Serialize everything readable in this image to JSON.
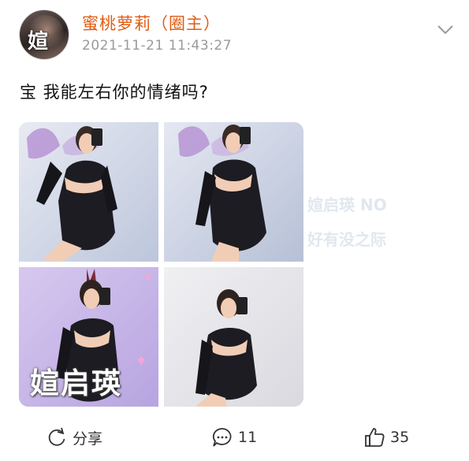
{
  "post": {
    "author": {
      "name": "蜜桃萝莉（圈主）",
      "avatar_watermark": "媗"
    },
    "timestamp": "2021-11-21 11:43:27",
    "text": "宝 我能左右你的情绪吗?",
    "images": [
      {
        "alt": "photo-1",
        "palette": "#d9dfec"
      },
      {
        "alt": "photo-2",
        "palette": "#d6dbe8"
      },
      {
        "alt": "photo-3",
        "palette": "#cfc4e6",
        "watermark": "媗启瑛"
      },
      {
        "alt": "photo-4",
        "palette": "#e6e6ea"
      }
    ],
    "ghost_text": [
      "媗启瑛 NO",
      "好有没之际"
    ],
    "actions": {
      "share_label": "分享",
      "comment_count": "11",
      "like_count": "35"
    }
  }
}
